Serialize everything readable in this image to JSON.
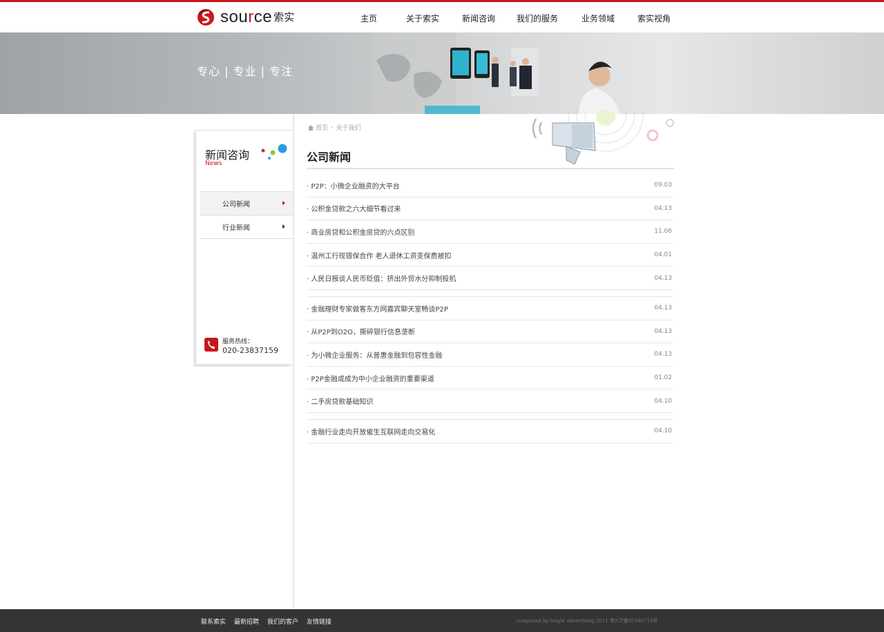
{
  "brand": {
    "name": "source",
    "name_cn": "索实"
  },
  "nav": [
    {
      "label": "主页"
    },
    {
      "label": "关于索实"
    },
    {
      "label": "新闻咨询"
    },
    {
      "label": "我们的服务"
    },
    {
      "label": "业务领域"
    },
    {
      "label": "索实视角"
    }
  ],
  "banner": {
    "slogan": "专心 | 专业 | 专注"
  },
  "sidebar": {
    "title": "新闻咨询",
    "subtitle": "News",
    "items": [
      {
        "label": "公司新闻",
        "active": true
      },
      {
        "label": "行业新闻",
        "active": false
      }
    ],
    "hotline_label": "服务热线：",
    "hotline_number": "020-23837159"
  },
  "breadcrumb": {
    "home": "首页",
    "current": "关于我们"
  },
  "main": {
    "title": "公司新闻",
    "news": [
      {
        "title": "· P2P：小微企业融资的大平台",
        "date": "09.03"
      },
      {
        "title": "· 公积金贷款之六大细节看过来",
        "date": "04.13"
      },
      {
        "title": "· 商业房贷和公积金房贷的六点区别",
        "date": "11.06"
      },
      {
        "title": "· 温州工行现银保合作 老人退休工资变保费被扣",
        "date": "04.01"
      },
      {
        "title": "· 人民日报谈人民币贬值：挤出外贸水分抑制投机",
        "date": "04.13"
      },
      {
        "title": "· 金融理财专家做客东方网嘉宾聊天室畅谈P2P",
        "date": "04.13"
      },
      {
        "title": "· 从P2P到O2O，撕碎银行信息垄断",
        "date": "04.13"
      },
      {
        "title": "· 为小微企业服务：从普惠金融到包容性金融",
        "date": "04.13"
      },
      {
        "title": "· P2P金融或成为中小企业融资的重要渠道",
        "date": "01.02"
      },
      {
        "title": "· 二手房贷款基础知识",
        "date": "04.10"
      },
      {
        "title": "· 金融行业走向开放催生互联网走向交易化",
        "date": "04.10"
      }
    ]
  },
  "footer": {
    "links": [
      {
        "label": "联系索实"
      },
      {
        "label": "最新招聘"
      },
      {
        "label": "我们的客户"
      },
      {
        "label": "友情链接"
      }
    ],
    "copyright": "composed by bright advertising   2011 粤ICP备05046719号"
  },
  "colors": {
    "accent": "#c8161d",
    "footer_bg": "#343434"
  }
}
